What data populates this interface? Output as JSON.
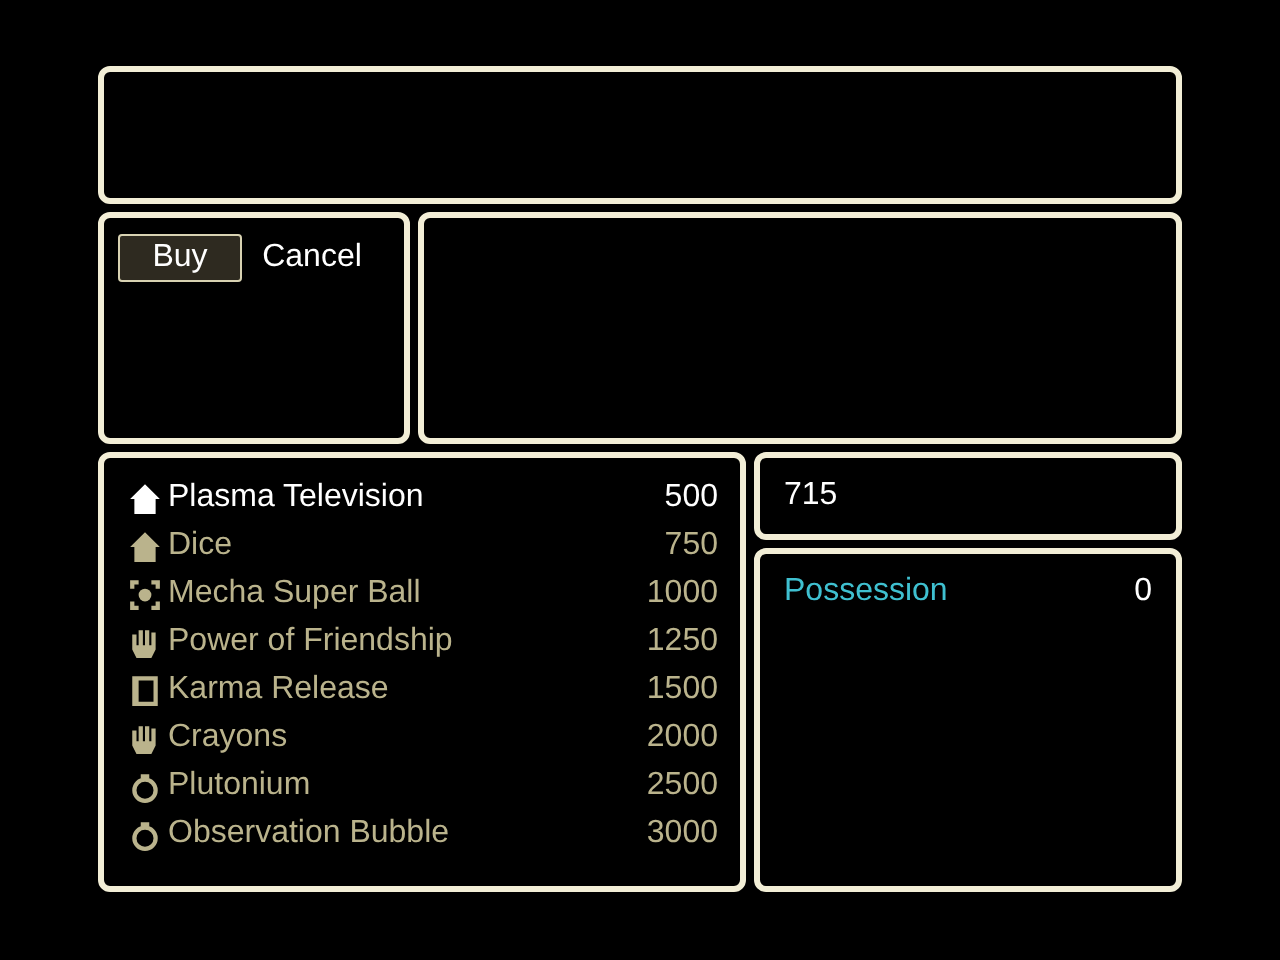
{
  "commands": [
    {
      "label": "Buy",
      "selected": true
    },
    {
      "label": "Cancel",
      "selected": false
    }
  ],
  "items": [
    {
      "kind": "house",
      "name": "Plasma Television",
      "price": "500",
      "disabled": false
    },
    {
      "kind": "house",
      "name": "Dice",
      "price": "750",
      "disabled": true
    },
    {
      "kind": "target",
      "name": "Mecha Super Ball",
      "price": "1000",
      "disabled": true
    },
    {
      "kind": "hand",
      "name": "Power of Friendship",
      "price": "1250",
      "disabled": true
    },
    {
      "kind": "book",
      "name": "Karma Release",
      "price": "1500",
      "disabled": true
    },
    {
      "kind": "hand",
      "name": "Crayons",
      "price": "2000",
      "disabled": true
    },
    {
      "kind": "ring",
      "name": "Plutonium",
      "price": "2500",
      "disabled": true
    },
    {
      "kind": "ring",
      "name": "Observation Bubble",
      "price": "3000",
      "disabled": true
    }
  ],
  "gold": "715",
  "possession": {
    "label": "Possession",
    "value": "0"
  }
}
